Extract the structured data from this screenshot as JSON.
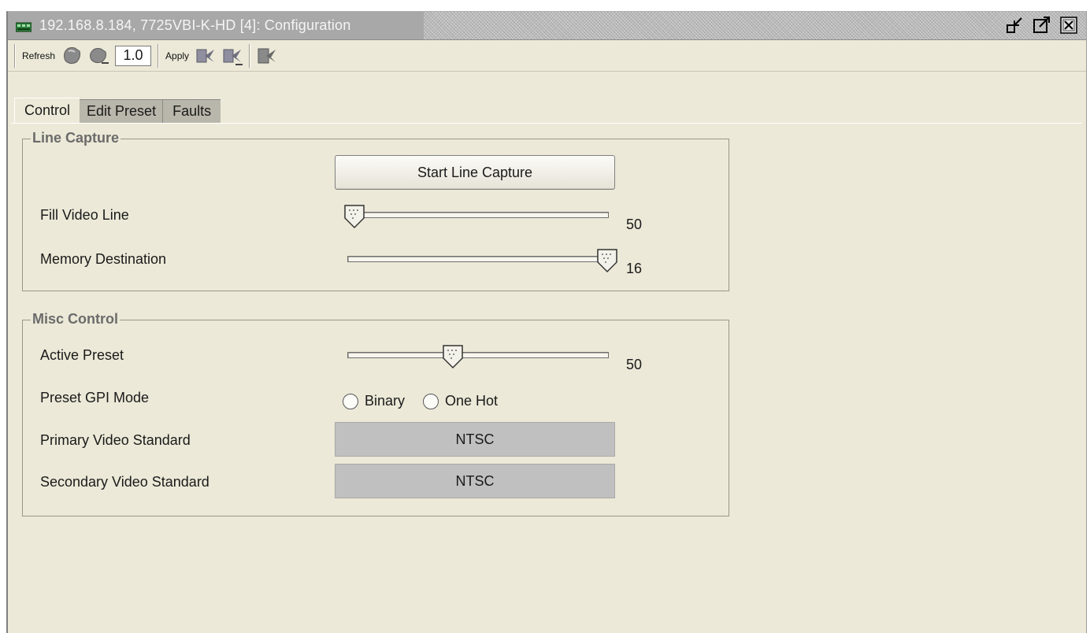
{
  "window": {
    "title": "192.168.8.184, 7725VBI-K-HD  [4]: Configuration",
    "buttons": [
      "restore-icon",
      "maximize-icon",
      "close-icon"
    ]
  },
  "toolbar": {
    "refresh_label": "Refresh",
    "version_value": "1.0",
    "apply_label": "Apply"
  },
  "tabs": [
    {
      "label": "Control",
      "active": true
    },
    {
      "label": "Edit Preset",
      "active": false
    },
    {
      "label": "Faults",
      "active": false
    }
  ],
  "line_capture": {
    "title": "Line Capture",
    "start_button": "Start Line Capture",
    "fill_video_line": {
      "label": "Fill Video Line",
      "value": "50",
      "position_fraction": 0.0
    },
    "memory_destination": {
      "label": "Memory Destination",
      "value": "16",
      "position_fraction": 1.0
    }
  },
  "misc_control": {
    "title": "Misc Control",
    "active_preset": {
      "label": "Active Preset",
      "value": "50",
      "position_fraction": 0.4
    },
    "preset_gpi_mode": {
      "label": "Preset GPI Mode",
      "options": [
        "Binary",
        "One Hot"
      ]
    },
    "primary_video_standard": {
      "label": "Primary Video Standard",
      "value": "NTSC"
    },
    "secondary_video_standard": {
      "label": "Secondary Video Standard",
      "value": "NTSC"
    }
  },
  "colors": {
    "panel_bg": "#ece9d8",
    "titlebar_bg": "#a8a8a8",
    "select_bg": "#c0c0c0",
    "group_title": "#6b6b6b"
  }
}
